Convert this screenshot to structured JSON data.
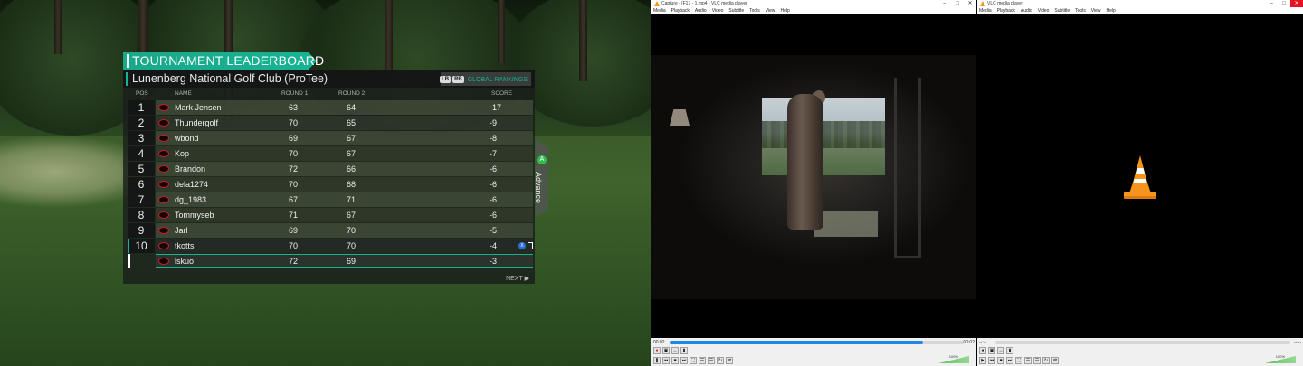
{
  "leaderboard": {
    "title": "TOURNAMENT LEADERBOARD",
    "venue": "Lunenberg National Golf Club (ProTee)",
    "rankings_lb": "LB",
    "rankings_rb": "RB",
    "rankings_label": "GLOBAL RANKINGS",
    "headers": {
      "pos": "POS",
      "name": "NAME",
      "round1": "ROUND 1",
      "round2": "ROUND 2",
      "score": "SCORE"
    },
    "rows": [
      {
        "pos": "1",
        "name": "Mark Jensen",
        "r1": "63",
        "r2": "64",
        "score": "-17"
      },
      {
        "pos": "2",
        "name": "Thundergolf",
        "r1": "70",
        "r2": "65",
        "score": "-9"
      },
      {
        "pos": "3",
        "name": "wbond",
        "r1": "69",
        "r2": "67",
        "score": "-8"
      },
      {
        "pos": "4",
        "name": "Kop",
        "r1": "70",
        "r2": "67",
        "score": "-7"
      },
      {
        "pos": "5",
        "name": "Brandon",
        "r1": "72",
        "r2": "66",
        "score": "-6"
      },
      {
        "pos": "6",
        "name": "dela1274",
        "r1": "70",
        "r2": "68",
        "score": "-6"
      },
      {
        "pos": "7",
        "name": "dg_1983",
        "r1": "67",
        "r2": "71",
        "score": "-6"
      },
      {
        "pos": "8",
        "name": "Tommyseb",
        "r1": "71",
        "r2": "67",
        "score": "-6"
      },
      {
        "pos": "9",
        "name": "Jarl",
        "r1": "69",
        "r2": "70",
        "score": "-5"
      },
      {
        "pos": "10",
        "name": "tkotts",
        "r1": "70",
        "r2": "70",
        "score": "-4"
      },
      {
        "pos": "",
        "name": "lskuo",
        "r1": "72",
        "r2": "69",
        "score": "-3"
      }
    ],
    "next_label": "NEXT",
    "advance_label": "Advance",
    "advance_button": "A"
  },
  "vlc1": {
    "title": "Capture - [F17 - 1.mp4 - VLC media player",
    "menu": [
      "Media",
      "Playback",
      "Audio",
      "Video",
      "Subtitle",
      "Tools",
      "View",
      "Help"
    ],
    "time_elapsed": "00:02",
    "time_total": "00:02",
    "seek_progress": 0.86,
    "volume_label": "100%"
  },
  "vlc2": {
    "title": "VLC media player",
    "menu": [
      "Media",
      "Playback",
      "Audio",
      "Video",
      "Subtitle",
      "Tools",
      "View",
      "Help"
    ],
    "time_elapsed": "--:--",
    "time_total": "--:--",
    "volume_label": "100%"
  },
  "colors": {
    "accent": "#18b394",
    "vlc_orange": "#f7941d",
    "close_red": "#e81123"
  }
}
